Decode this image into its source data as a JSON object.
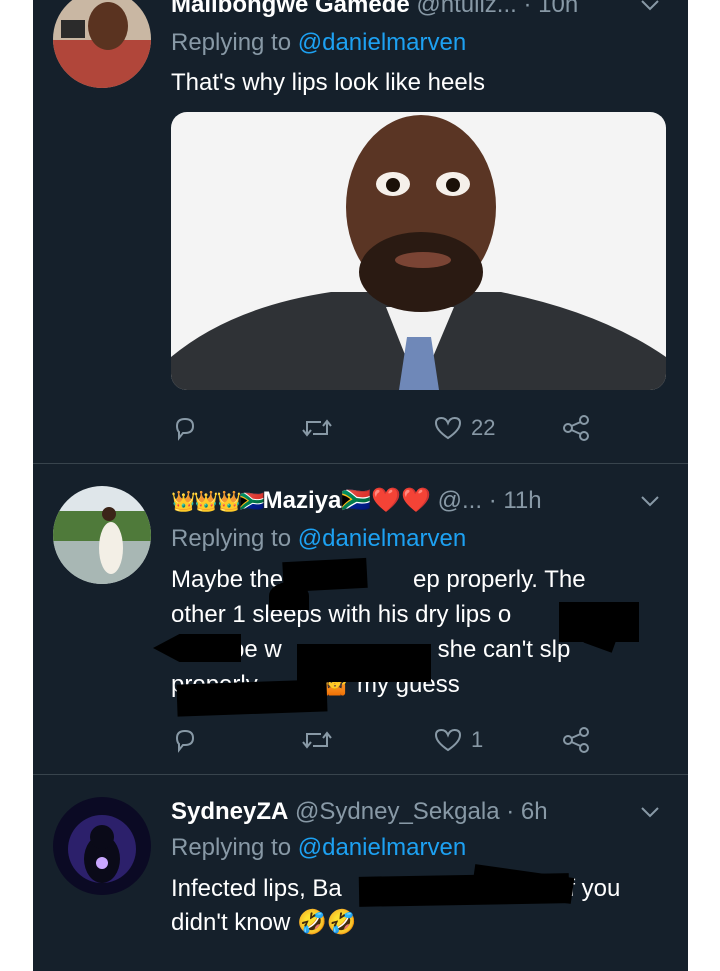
{
  "tweets": [
    {
      "name": "Malibongwe Gamede",
      "handle": "@ntuliz...",
      "time": "· 10h",
      "replying_prefix": "Replying to ",
      "replying_handle": "@danielmarven",
      "text": "That's why lips look like heels",
      "actions": {
        "reply_count": "",
        "retweet_count": "",
        "like_count": "22",
        "share_count": ""
      }
    },
    {
      "name_prefix_emoji": "👑👑👑🇿🇦",
      "name": "Maziya",
      "name_suffix_emoji": "🇿🇦❤️❤️",
      "handle": "@...",
      "time": "· 11h",
      "replying_prefix": "Replying to ",
      "replying_handle": "@danielmarven",
      "text_lines": [
        "Maybe they ca",
        "ep properly. The",
        "other 1 sleeps with his dry lips o",
        "be w",
        "cz she can't slp",
        "properly",
        "my guess"
      ],
      "actions": {
        "reply_count": "",
        "retweet_count": "",
        "like_count": "1",
        "share_count": ""
      }
    },
    {
      "name": "SydneyZA",
      "handle": "@Sydney_Sekgala",
      "time": "· 6h",
      "replying_prefix": "Replying to ",
      "replying_handle": "@danielmarven",
      "text_lines": [
        "Infected lips, Ba",
        "if you",
        "didn't know 🤣🤣"
      ],
      "actions": {
        "reply_count": "",
        "retweet_count": "",
        "like_count": "",
        "share_count": ""
      }
    }
  ],
  "colors": {
    "background": "#15202b",
    "text_primary": "#ffffff",
    "text_secondary": "#8899a6",
    "link": "#1da1f2",
    "divider": "#38444d"
  },
  "icons": [
    "reply-icon",
    "retweet-icon",
    "like-icon",
    "share-icon",
    "chevron-down-icon"
  ]
}
